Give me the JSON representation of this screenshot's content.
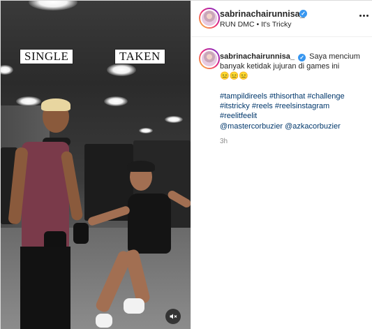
{
  "post": {
    "username": "sabrinachairunnisa_",
    "audio_label": "RUN DMC • It's Tricky",
    "more_icon": "more-options-icon",
    "verified_icon": "verified-badge-icon"
  },
  "media": {
    "overlay_left": "SINGLE",
    "overlay_right": "TAKEN",
    "mute_icon": "audio-muted-icon"
  },
  "caption": {
    "username": "sabrinachairunnisa_",
    "text": "Saya mencium banyak ketidak jujuran di games ini",
    "emojis": "😑😑😑",
    "hashtags": [
      "#tampildireels",
      "#thisorthat",
      "#challenge",
      "#itstricky",
      "#reels",
      "#reelsinstagram",
      "#reelitfeelit"
    ],
    "mentions": [
      "@mastercorbuzier",
      "@azkacorbuzier"
    ],
    "time": "3h"
  },
  "colors": {
    "link": "#00376b",
    "verified": "#3897f0",
    "muted_text": "#8e8e8e"
  }
}
